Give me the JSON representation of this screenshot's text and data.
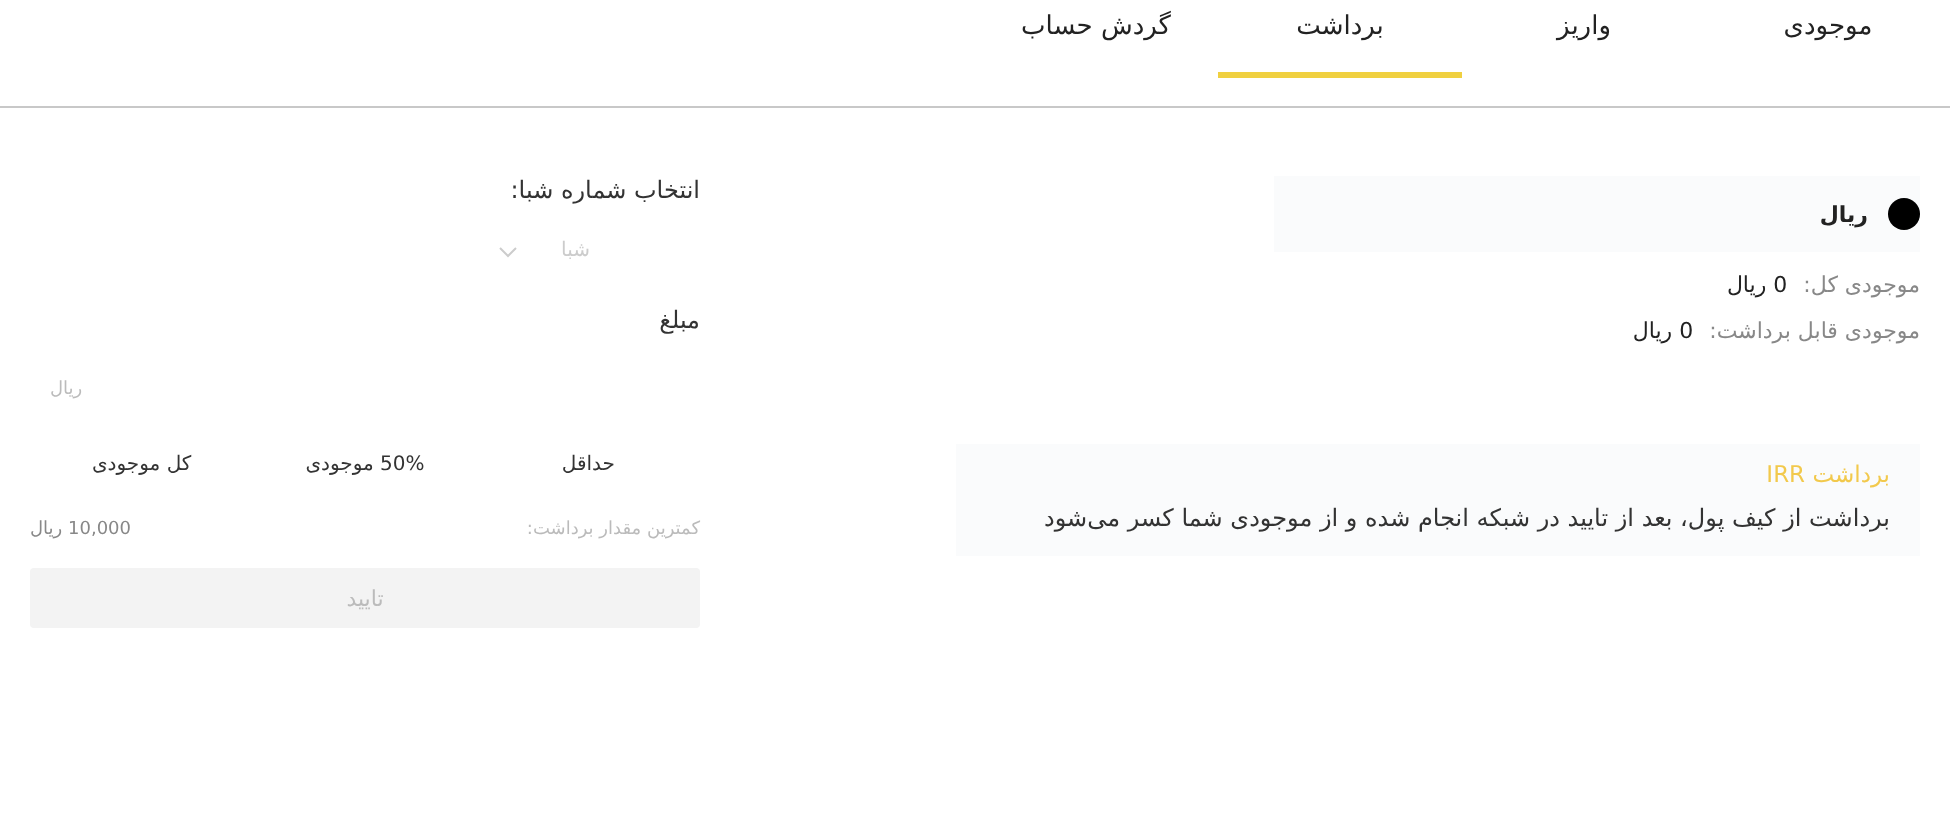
{
  "tabs": [
    {
      "label": "موجودی",
      "selected": false
    },
    {
      "label": "واریز",
      "selected": false
    },
    {
      "label": "برداشت",
      "selected": true
    },
    {
      "label": "گردش حساب",
      "selected": false
    }
  ],
  "currency": {
    "name": "ریال"
  },
  "balances": [
    {
      "label": "موجودی کل:",
      "value": "0 ریال"
    },
    {
      "label": "موجودی قابل برداشت:",
      "value": "0 ریال"
    }
  ],
  "notice": {
    "title": "برداشت IRR",
    "text": "برداشت از کیف پول، بعد از تایید در شبکه انجام شده و از موجودی شما کسر می‌شود"
  },
  "form": {
    "sheba_label": "انتخاب شماره شبا:",
    "sheba_select": {
      "placeholder": "شبا"
    },
    "amount_label": "مبلغ",
    "amount_field": {
      "placeholder": "ریال"
    },
    "quick_amounts": [
      "حداقل",
      "50% موجودی",
      "کل موجودی"
    ],
    "min_label": "کمترین مقدار برداشت:",
    "min_value": "10,000 ریال",
    "submit": {
      "label": "تایید",
      "disabled": true
    }
  }
}
